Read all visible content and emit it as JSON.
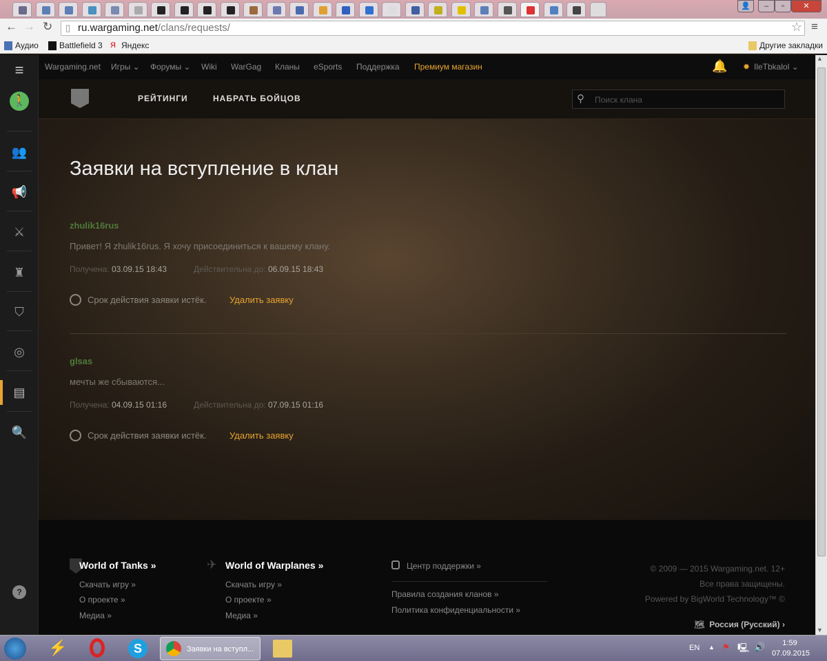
{
  "browser": {
    "url_domain": "ru.wargaming.net",
    "url_path": "/clans/requests/",
    "bookmarks": [
      "Аудио",
      "Battlefield 3",
      "Яндекс"
    ],
    "other_bookmarks": "Другие закладки"
  },
  "topnav": {
    "items": [
      "Wargaming.net",
      "Игры",
      "Форумы",
      "Wiki",
      "WarGag",
      "Кланы",
      "eSports",
      "Поддержка"
    ],
    "premium": "Премиум магазин",
    "username": "IleTbkalol",
    "accent": "#e8a531"
  },
  "clan_nav": {
    "ratings": "РЕЙТИНГИ",
    "recruit": "НАБРАТЬ БОЙЦОВ",
    "search_placeholder": "Поиск клана"
  },
  "page_title": "Заявки на вступление в клан",
  "labels": {
    "received": "Получена:",
    "valid_until": "Действительна до:",
    "expired": "Срок действия заявки истёк.",
    "delete": "Удалить заявку"
  },
  "requests": [
    {
      "name": "zhulik16rus",
      "message": "Привет! Я zhulik16rus. Я хочу присоединиться к вашему клану.",
      "received": "03.09.15 18:43",
      "valid_until": "06.09.15 18:43"
    },
    {
      "name": "glsas",
      "message": "мечты же сбываются...",
      "received": "04.09.15 01:16",
      "valid_until": "07.09.15 01:16"
    }
  ],
  "footer": {
    "wot": {
      "title": "World of Tanks »",
      "links": [
        "Скачать игру »",
        "О проекте »",
        "Медиа »"
      ]
    },
    "wowp": {
      "title": "World of Warplanes »",
      "links": [
        "Скачать игру »",
        "О проекте »",
        "Медиа »"
      ]
    },
    "support": "Центр поддержки »",
    "links": [
      "Правила создания кланов »",
      "Политика конфиденциальности »"
    ],
    "copyright": [
      "© 2009 — 2015 Wargaming.net. 12+",
      "Все права защищены.",
      "Powered by BigWorld Technology™ ©"
    ],
    "region": "Россия (Русский)"
  },
  "taskbar": {
    "window": "Заявки на вступл...",
    "lang": "EN",
    "time": "1:59",
    "date": "07.09.2015"
  }
}
